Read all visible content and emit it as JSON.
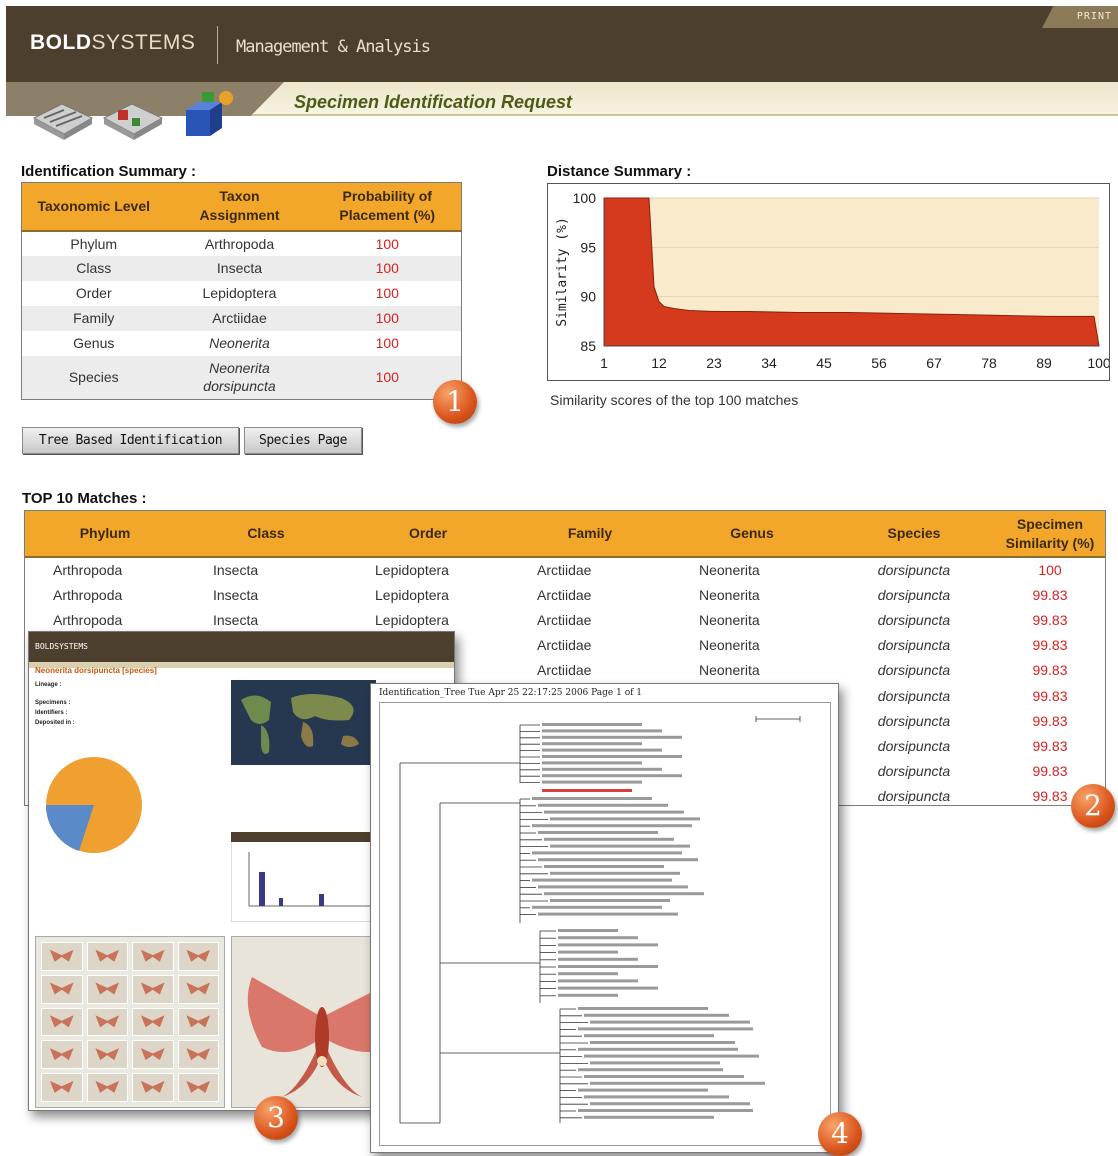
{
  "header": {
    "brand_bold": "BOLD",
    "brand_light": "SYSTEMS",
    "subtitle": "Management & Analysis",
    "print_label": "PRINT"
  },
  "page_title": "Specimen Identification Request",
  "identification_summary": {
    "heading": "Identification Summary :",
    "columns": [
      "Taxonomic Level",
      "Taxon Assignment",
      "Probability of Placement (%)"
    ],
    "rows": [
      {
        "level": "Phylum",
        "taxon": "Arthropoda",
        "prob": "100"
      },
      {
        "level": "Class",
        "taxon": "Insecta",
        "prob": "100"
      },
      {
        "level": "Order",
        "taxon": "Lepidoptera",
        "prob": "100"
      },
      {
        "level": "Family",
        "taxon": "Arctiidae",
        "prob": "100"
      },
      {
        "level": "Genus",
        "taxon": "Neonerita",
        "prob": "100"
      },
      {
        "level": "Species",
        "taxon": "Neonerita dorsipuncta",
        "prob": "100"
      }
    ]
  },
  "buttons": {
    "tree_based": "Tree Based Identification",
    "species_page": "Species Page"
  },
  "distance_summary": {
    "heading": "Distance Summary :",
    "caption": "Similarity scores of the top 100 matches"
  },
  "chart_data": {
    "type": "area",
    "title": "",
    "xlabel": "",
    "ylabel": "Similarity (%)",
    "x_ticks": [
      "1",
      "12",
      "23",
      "34",
      "45",
      "56",
      "67",
      "78",
      "89",
      "100"
    ],
    "y_ticks": [
      "85",
      "90",
      "95",
      "100"
    ],
    "xlim": [
      1,
      100
    ],
    "ylim": [
      85,
      100
    ],
    "grid": true,
    "x": [
      1,
      10,
      11,
      12,
      13,
      15,
      18,
      23,
      30,
      40,
      50,
      60,
      70,
      80,
      90,
      99,
      100
    ],
    "y": [
      100,
      100,
      91,
      89.5,
      89,
      88.8,
      88.6,
      88.5,
      88.5,
      88.4,
      88.4,
      88.3,
      88.2,
      88.1,
      88.0,
      88.0,
      85
    ],
    "colors": {
      "fill": "#d53a1c",
      "background": "#f8ebcc",
      "grid": "#e3d3ad"
    }
  },
  "callouts": [
    "1",
    "2",
    "3",
    "4"
  ],
  "top_matches": {
    "heading": "TOP 10 Matches :",
    "columns": [
      "Phylum",
      "Class",
      "Order",
      "Family",
      "Genus",
      "Species",
      "Specimen Similarity (%)"
    ],
    "rows": [
      {
        "phylum": "Arthropoda",
        "class": "Insecta",
        "order": "Lepidoptera",
        "family": "Arctiidae",
        "genus": "Neonerita",
        "species": "dorsipuncta",
        "similarity": "100"
      },
      {
        "phylum": "Arthropoda",
        "class": "Insecta",
        "order": "Lepidoptera",
        "family": "Arctiidae",
        "genus": "Neonerita",
        "species": "dorsipuncta",
        "similarity": "99.83"
      },
      {
        "phylum": "Arthropoda",
        "class": "Insecta",
        "order": "Lepidoptera",
        "family": "Arctiidae",
        "genus": "Neonerita",
        "species": "dorsipuncta",
        "similarity": "99.83"
      },
      {
        "phylum": "",
        "class": "",
        "order": "",
        "family": "Arctiidae",
        "genus": "Neonerita",
        "species": "dorsipuncta",
        "similarity": "99.83"
      },
      {
        "phylum": "",
        "class": "",
        "order": "",
        "family": "Arctiidae",
        "genus": "Neonerita",
        "species": "dorsipuncta",
        "similarity": "99.83"
      },
      {
        "phylum": "",
        "class": "",
        "order": "",
        "family": "",
        "genus": "",
        "species": "dorsipuncta",
        "similarity": "99.83"
      },
      {
        "phylum": "",
        "class": "",
        "order": "",
        "family": "",
        "genus": "",
        "species": "dorsipuncta",
        "similarity": "99.83"
      },
      {
        "phylum": "",
        "class": "",
        "order": "",
        "family": "",
        "genus": "",
        "species": "dorsipuncta",
        "similarity": "99.83"
      },
      {
        "phylum": "",
        "class": "",
        "order": "",
        "family": "",
        "genus": "",
        "species": "dorsipuncta",
        "similarity": "99.83"
      },
      {
        "phylum": "",
        "class": "",
        "order": "",
        "family": "",
        "genus": "",
        "species": "dorsipuncta",
        "similarity": "99.83"
      }
    ]
  },
  "species_page_screenshot": {
    "brand": "BOLDSYSTEMS",
    "title": "Neonerita dorsipuncta [species]",
    "labels": [
      "Lineage :",
      "Specimens :",
      "Identifiers :",
      "Deposited in :"
    ]
  },
  "tree_screenshot": {
    "header": "Identification_Tree  Tue Apr 25 22:17:25 2006  Page 1 of 1"
  }
}
